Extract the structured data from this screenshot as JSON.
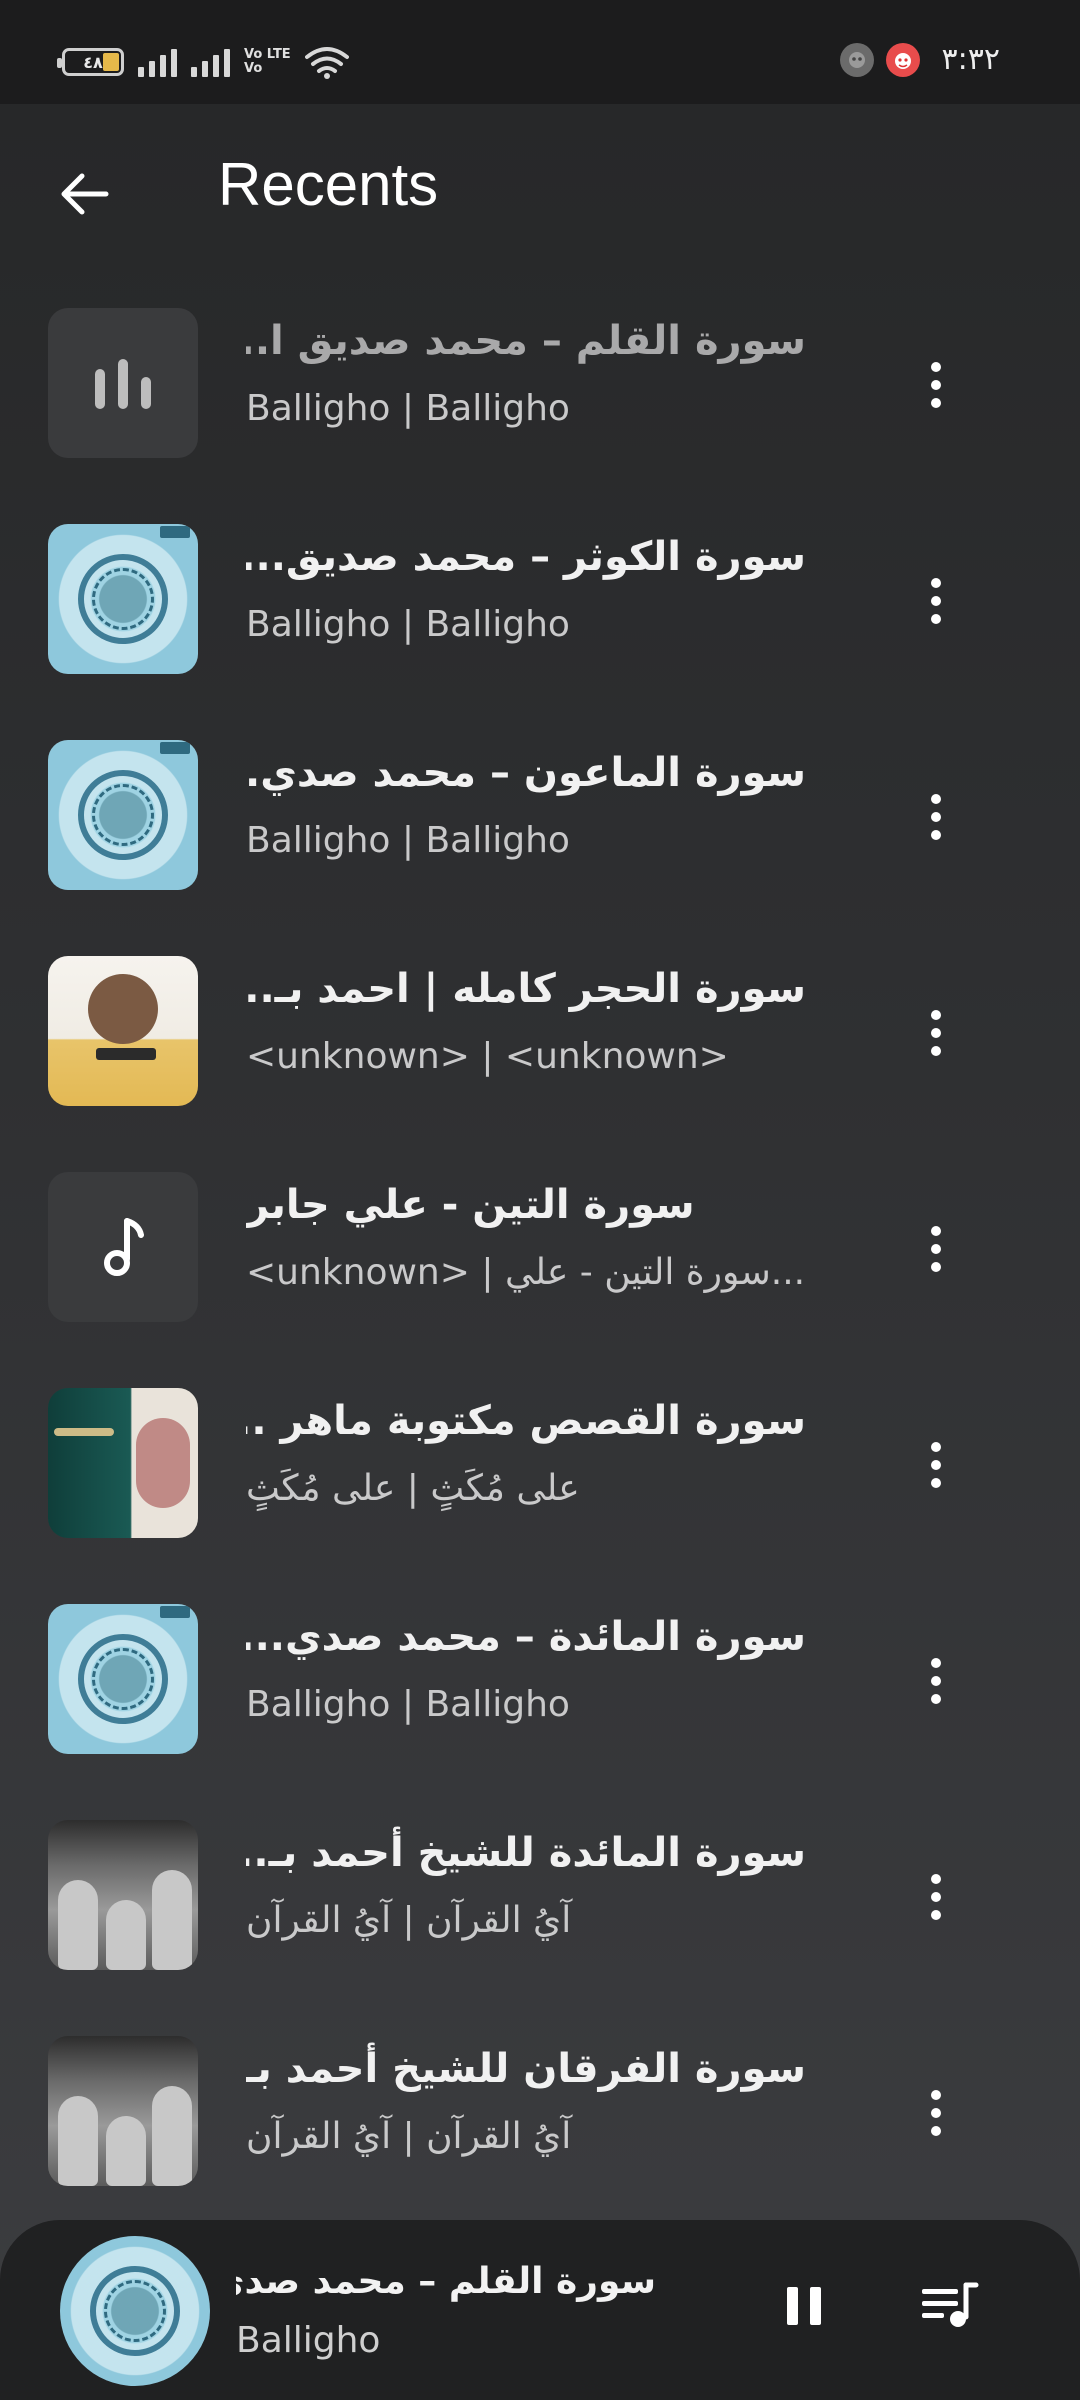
{
  "status_bar": {
    "battery_level": "٤٨",
    "network_labels": [
      "Vo LTE",
      "Vo"
    ],
    "time": "٣:٣٢"
  },
  "header": {
    "title": "Recents"
  },
  "recents": [
    {
      "title": "سورة القلم – محمد صديق ا...",
      "subtitle": "Balligho | Balligho",
      "thumbnail": "equalizer-icon",
      "now_playing": true
    },
    {
      "title": "سورة الكوثر – محمد صديق...",
      "subtitle": "Balligho | Balligho",
      "thumbnail": "quran-cover-art"
    },
    {
      "title": "سورة الماعون – محمد صدي...",
      "subtitle": "Balligho | Balligho",
      "thumbnail": "quran-cover-art"
    },
    {
      "title": "سورة الحجر كامله | احمد بـ...",
      "subtitle": "<unknown> | <unknown>",
      "thumbnail": "reciter-portrait-art"
    },
    {
      "title": "سورة التين - علي جابر",
      "subtitle": "<unknown> | سورة التين - علي...",
      "thumbnail": "music-note-icon"
    },
    {
      "title": "سورة القصص مكتوبة ماهر ...",
      "subtitle": "على مُكَثٍ | على مُكَثٍ",
      "thumbnail": "reciter-green-art"
    },
    {
      "title": "سورة المائدة – محمد صدي...",
      "subtitle": "Balligho | Balligho",
      "thumbnail": "quran-cover-art"
    },
    {
      "title": "سورة المائدة للشيخ أحمد بـ...",
      "subtitle": "آيُ القرآن | آيُ القرآن",
      "thumbnail": "mosque-gray-art"
    },
    {
      "title": "سورة الفرقان للشيخ أحمد بـ...",
      "subtitle": "آيُ القرآن | آيُ القرآن",
      "thumbnail": "mosque-gray-art"
    }
  ],
  "mini_player": {
    "title": "سورة القلم – محمد صدي...",
    "artist": "Balligho",
    "state": "playing"
  },
  "colors": {
    "background_top": "#262728",
    "background_bottom": "#3c3d40",
    "mini_player_bg": "#202122",
    "placeholder_tile": "#3a3b3d"
  }
}
